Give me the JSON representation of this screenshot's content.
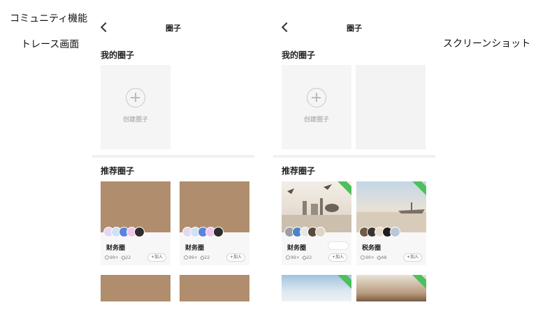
{
  "labels": {
    "feature": "コミュニティ機能",
    "trace": "トレース画面",
    "screenshot": "スクリーンショット"
  },
  "screens": [
    {
      "nav_title": "圈子",
      "my_section": "我的圈子",
      "create_label": "创建圈子",
      "recommended_section": "推荐圈子",
      "cards": [
        {
          "name": "财务圈",
          "members": "99+",
          "posts": "22",
          "join": "+加入",
          "image_color": "#b08d6d"
        },
        {
          "name": "财务圈",
          "members": "99+",
          "posts": "22",
          "join": "+加入",
          "image_color": "#b08d6d"
        }
      ],
      "next_row_colors": [
        "#b08d6d",
        "#b08d6d"
      ]
    },
    {
      "nav_title": "圈子",
      "my_section": "我的圈子",
      "create_label": "创建圈子",
      "recommended_section": "推荐圈子",
      "cards": [
        {
          "name": "财务圈",
          "members": "99+",
          "posts": "22",
          "join": "+加入"
        },
        {
          "name": "税务圈",
          "members": "99+",
          "posts": "48",
          "join": "+加入"
        }
      ]
    }
  ],
  "colors": {
    "placeholder": "#b08d6d",
    "badge_green": "#4cc05b"
  }
}
